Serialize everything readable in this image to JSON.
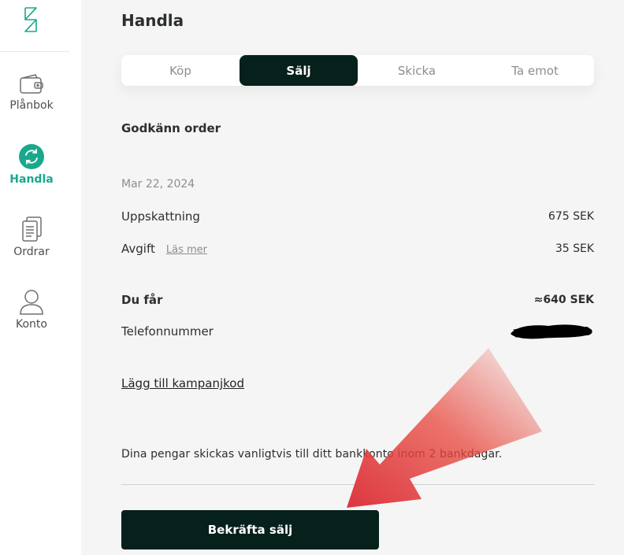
{
  "colors": {
    "accent": "#1aa88c",
    "dark": "#06201c",
    "background": "#f4f5f4",
    "muted_text": "#8a8f8d",
    "annotation_arrow": "#e03a3a"
  },
  "sidebar": {
    "logo_icon": "brand-logo-icon",
    "items": [
      {
        "label": "Plånbok",
        "icon": "wallet-icon",
        "active": false
      },
      {
        "label": "Handla",
        "icon": "trade-cycle-icon",
        "active": true
      },
      {
        "label": "Ordrar",
        "icon": "orders-icon",
        "active": false
      },
      {
        "label": "Konto",
        "icon": "user-icon",
        "active": false
      }
    ]
  },
  "main": {
    "title": "Handla",
    "tabs": [
      {
        "label": "Köp",
        "active": false
      },
      {
        "label": "Sälj",
        "active": true
      },
      {
        "label": "Skicka",
        "active": false
      },
      {
        "label": "Ta emot",
        "active": false
      }
    ],
    "section_title": "Godkänn order",
    "date": "Mar 22, 2024",
    "estimate": {
      "label": "Uppskattning",
      "value": "675 SEK"
    },
    "fee": {
      "label": "Avgift",
      "link": "Läs mer",
      "value": "35 SEK"
    },
    "receive": {
      "label": "Du får",
      "value": "≈640 SEK"
    },
    "phone": {
      "label": "Telefonnummer"
    },
    "promo_link": "Lägg till kampanjkod",
    "info_text": "Dina pengar skickas vanligtvis till ditt bankkonto inom 2 bankdagar.",
    "confirm_button": "Bekräfta sälj"
  }
}
